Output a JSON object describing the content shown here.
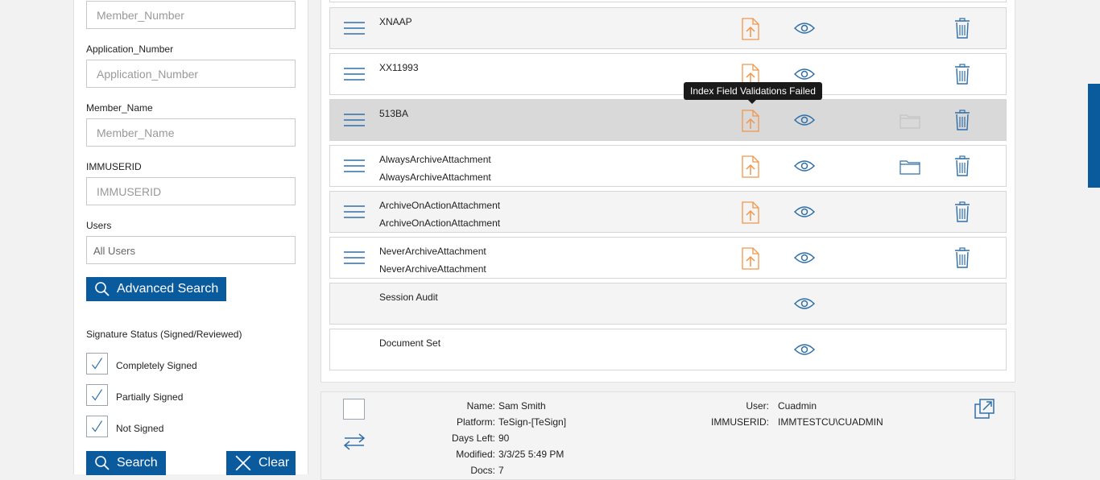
{
  "filters": {
    "member_number_placeholder": "Member_Number",
    "application_number_label": "Application_Number",
    "application_number_placeholder": "Application_Number",
    "member_name_label": "Member_Name",
    "member_name_placeholder": "Member_Name",
    "immuserid_label": "IMMUSERID",
    "immuserid_placeholder": "IMMUSERID",
    "users_label": "Users",
    "users_value": "All Users",
    "advanced_search_label": "Advanced Search",
    "signature_status_label": "Signature Status (Signed/Reviewed)",
    "checkboxes": [
      {
        "label": "Completely Signed",
        "checked": true
      },
      {
        "label": "Partially Signed",
        "checked": true
      },
      {
        "label": "Not Signed",
        "checked": true
      }
    ],
    "search_label": "Search",
    "clear_label": "Clear"
  },
  "documents": [
    {
      "title": "XNAAP",
      "subtitle": "",
      "has_menu": true,
      "has_upload": true,
      "has_folder": false,
      "has_trash": true
    },
    {
      "title": "XX11993",
      "subtitle": "",
      "has_menu": true,
      "has_upload": true,
      "has_folder": false,
      "has_trash": true
    },
    {
      "title": "513BA",
      "subtitle": "",
      "has_menu": true,
      "has_upload": true,
      "has_folder": true,
      "has_trash": true
    },
    {
      "title": "AlwaysArchiveAttachment",
      "subtitle": "AlwaysArchiveAttachment",
      "has_menu": true,
      "has_upload": true,
      "has_folder": true,
      "has_trash": true
    },
    {
      "title": "ArchiveOnActionAttachment",
      "subtitle": "ArchiveOnActionAttachment",
      "has_menu": true,
      "has_upload": true,
      "has_folder": false,
      "has_trash": true
    },
    {
      "title": "NeverArchiveAttachment",
      "subtitle": "NeverArchiveAttachment",
      "has_menu": true,
      "has_upload": true,
      "has_folder": false,
      "has_trash": true
    },
    {
      "title": "Session Audit",
      "subtitle": "",
      "has_menu": false,
      "has_upload": false,
      "has_folder": false,
      "has_trash": false
    },
    {
      "title": "Document Set",
      "subtitle": "",
      "has_menu": false,
      "has_upload": false,
      "has_folder": false,
      "has_trash": false
    }
  ],
  "tooltip": "Index Field Validations Failed",
  "info": {
    "name_key": "Name:",
    "name_val": "Sam Smith",
    "platform_key": "Platform:",
    "platform_val": "TeSign-[TeSign]",
    "days_left_key": "Days Left:",
    "days_left_val": "90",
    "modified_key": "Modified:",
    "modified_val": "3/3/25 5:49 PM",
    "docs_key": "Docs:",
    "docs_val": "7",
    "user_key": "User:",
    "user_val": "Cuadmin",
    "immuserid_key": "IMMUSERID:",
    "immuserid_val": "IMMTESTCU\\CUADMIN"
  },
  "colors": {
    "accent": "#0a5a9e",
    "upload_orange": "#f0964a",
    "icon_blue": "#2f6fa8"
  }
}
